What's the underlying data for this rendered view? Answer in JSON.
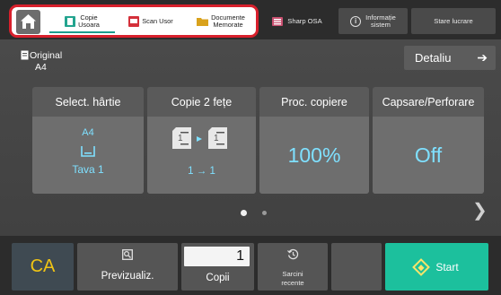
{
  "topbar": {
    "shortcuts": [
      {
        "label_1": "Copie",
        "label_2": "Usoara",
        "icon": "easy-copy-icon"
      },
      {
        "label_1": "Scan Usor",
        "label_2": "",
        "icon": "easy-scan-icon"
      },
      {
        "label_1": "Documente",
        "label_2": "Memorate",
        "icon": "stored-documents-icon"
      }
    ],
    "sharp_osa": "Sharp OSA",
    "info": {
      "label_1": "Informație",
      "label_2": "sistem"
    },
    "job_status": "Stare lucrare",
    "colors": {
      "highlight_border": "#d8202c",
      "active_underline": "#1c9e8e"
    }
  },
  "original": {
    "label": "Original",
    "size": "A4"
  },
  "detail_button": "Detaliu",
  "tiles": {
    "paper": {
      "title": "Select. hârtie",
      "size": "A4",
      "tray": "Tava 1"
    },
    "duplex": {
      "title": "Copie 2 fețe",
      "mode": "1 → 1"
    },
    "ratio": {
      "title": "Proc. copiere",
      "value": "100%"
    },
    "staple": {
      "title": "Capsare/Perforare",
      "value": "Off"
    }
  },
  "bottombar": {
    "ca": "CA",
    "preview": "Previzualiz.",
    "copies_value": "1",
    "copies_label": "Copii",
    "recent_1": "Sarcini",
    "recent_2": "recente",
    "start": "Start",
    "colors": {
      "ca_text": "#f0c414",
      "start_bg": "#1cc09d",
      "value_text": "#7fe0ff"
    }
  },
  "pager": {
    "pages": 2,
    "current": 1
  }
}
